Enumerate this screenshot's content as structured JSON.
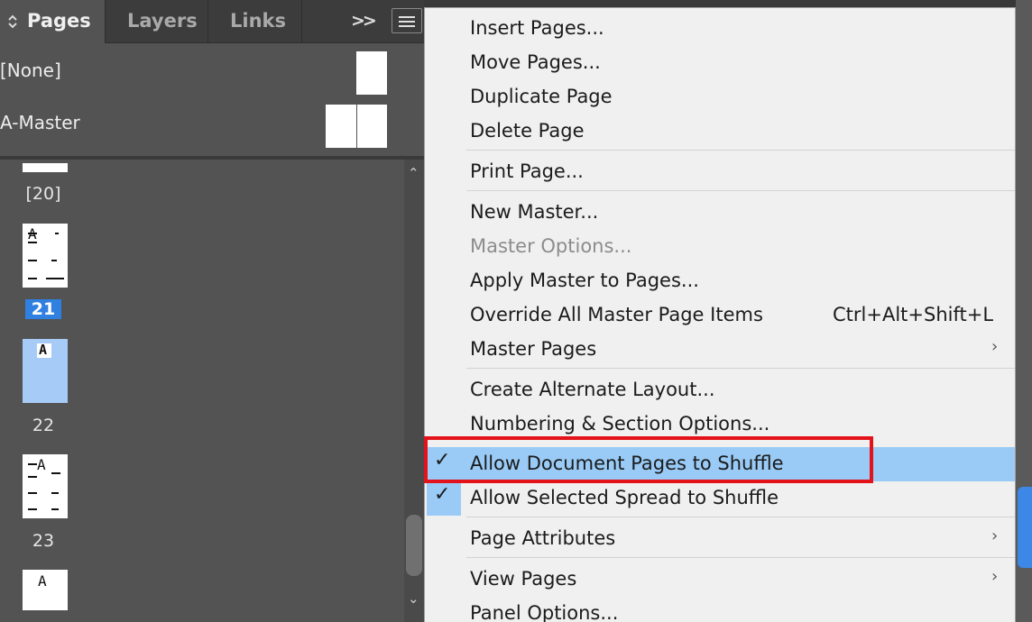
{
  "panel": {
    "tabs": [
      {
        "label": "Pages",
        "active": true
      },
      {
        "label": "Layers",
        "active": false
      },
      {
        "label": "Links",
        "active": false
      }
    ],
    "overflow_icon": ">>",
    "masters": [
      {
        "label": "[None]"
      },
      {
        "label": "A-Master"
      }
    ],
    "pages": [
      {
        "label": "[20]",
        "selected": false
      },
      {
        "label": "21",
        "selected": true,
        "thumb_letter": "A"
      },
      {
        "label": "22",
        "selected": false,
        "thumb_letter": "A"
      },
      {
        "label": "23",
        "selected": false,
        "thumb_letter": "A"
      },
      {
        "thumb_letter": "A"
      }
    ]
  },
  "menu": {
    "items": [
      {
        "label": "Insert Pages..."
      },
      {
        "label": "Move Pages..."
      },
      {
        "label": "Duplicate Page"
      },
      {
        "label": "Delete Page"
      },
      {
        "label": "Print Page..."
      },
      {
        "label": "New Master..."
      },
      {
        "label": "Master Options...",
        "disabled": true
      },
      {
        "label": "Apply Master to Pages..."
      },
      {
        "label": "Override All Master Page Items",
        "shortcut": "Ctrl+Alt+Shift+L"
      },
      {
        "label": "Master Pages",
        "submenu": true
      },
      {
        "label": "Create Alternate Layout..."
      },
      {
        "label": "Numbering & Section Options..."
      },
      {
        "label": "Allow Document Pages to Shuffle",
        "checked": true,
        "highlighted": true
      },
      {
        "label": "Allow Selected Spread to Shuffle",
        "checked": true
      },
      {
        "label": "Page Attributes",
        "submenu": true
      },
      {
        "label": "View Pages",
        "submenu": true
      },
      {
        "label": "Panel Options..."
      }
    ]
  },
  "colors": {
    "highlight": "#99cbf6",
    "selection_red": "#e4121a",
    "selected_page": "#2f80e0"
  }
}
